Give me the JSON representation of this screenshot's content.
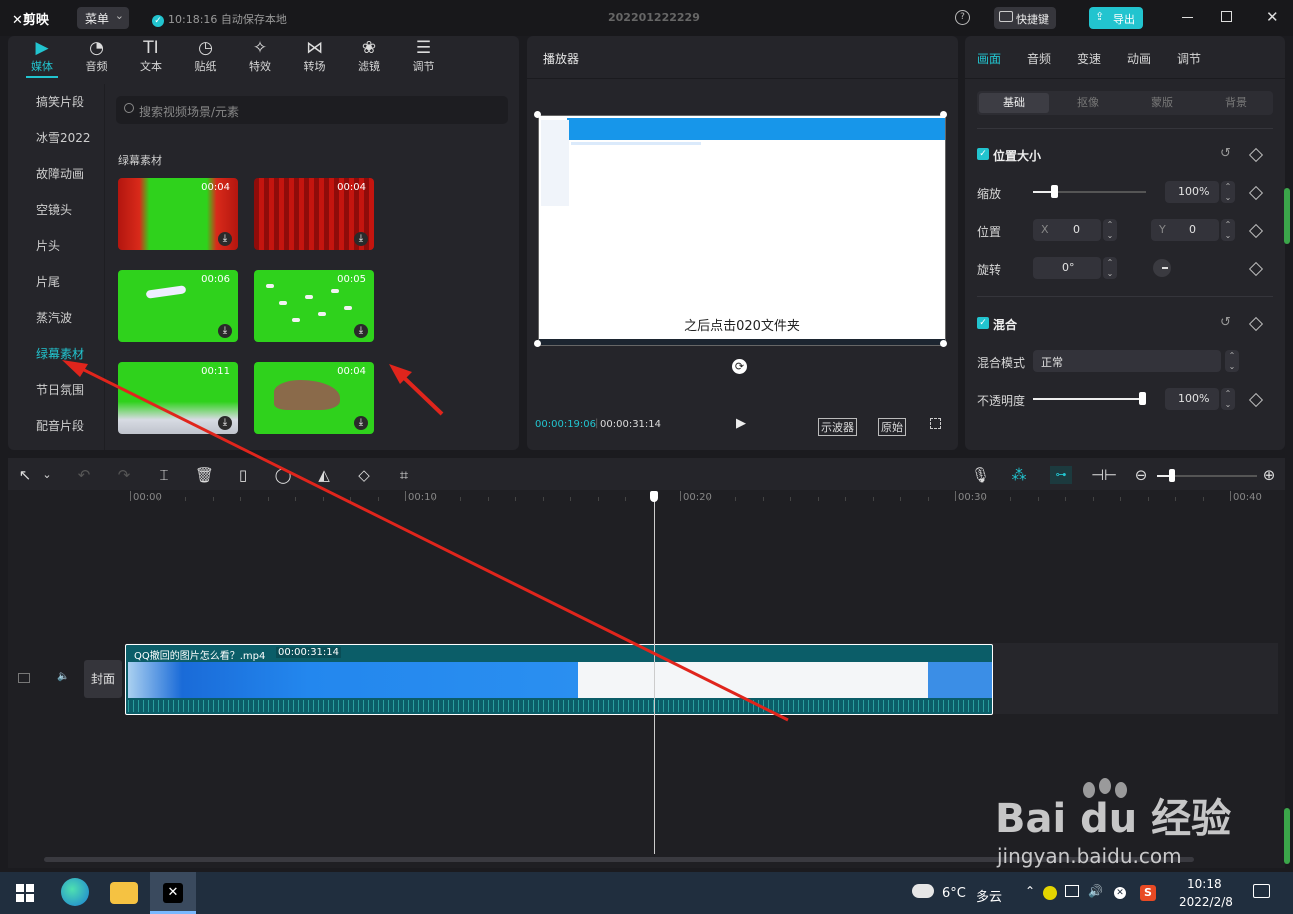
{
  "app": {
    "logo": "剪映",
    "menu_label": "菜单",
    "autosave": "10:18:16 自动保存本地",
    "project_title": "202201222229",
    "shortcut_label": "快捷键",
    "export_label": "导出"
  },
  "media_toolbar": [
    {
      "icon": "media-icon",
      "glyph": "▶",
      "label": "媒体"
    },
    {
      "icon": "audio-icon",
      "glyph": "◔",
      "label": "音频"
    },
    {
      "icon": "text-icon",
      "glyph": "TI",
      "label": "文本"
    },
    {
      "icon": "sticker-icon",
      "glyph": "◷",
      "label": "贴纸"
    },
    {
      "icon": "effects-icon",
      "glyph": "✧",
      "label": "特效"
    },
    {
      "icon": "transition-icon",
      "glyph": "⋈",
      "label": "转场"
    },
    {
      "icon": "filter-icon",
      "glyph": "❀",
      "label": "滤镜"
    },
    {
      "icon": "adjust-icon",
      "glyph": "☰",
      "label": "调节"
    }
  ],
  "categories": [
    "搞笑片段",
    "冰雪2022",
    "故障动画",
    "空镜头",
    "片头",
    "片尾",
    "蒸汽波",
    "绿幕素材",
    "节日氛围",
    "配音片段"
  ],
  "active_category": "绿幕素材",
  "search_placeholder": "搜索视频场景/元素",
  "section_title": "绿幕素材",
  "thumbnails": [
    {
      "duration": "00:04",
      "kind": "curtain-green"
    },
    {
      "duration": "00:04",
      "kind": "curtain-red"
    },
    {
      "duration": "00:06",
      "kind": "plane"
    },
    {
      "duration": "00:05",
      "kind": "birds"
    },
    {
      "duration": "00:11",
      "kind": "clouds"
    },
    {
      "duration": "00:04",
      "kind": "dinosaur"
    }
  ],
  "player": {
    "title": "播放器",
    "subtitle": "之后点击020文件夹",
    "current_time": "00:00:19:06",
    "total_time": "00:00:31:14",
    "scope_label": "示波器",
    "original_label": "原始"
  },
  "inspector": {
    "tabs": [
      "画面",
      "音频",
      "变速",
      "动画",
      "调节"
    ],
    "active_tab": "画面",
    "subtabs": [
      "基础",
      "抠像",
      "蒙版",
      "背景"
    ],
    "active_subtab": "基础",
    "position_size": {
      "title": "位置大小",
      "scale_label": "缩放",
      "scale_value": "100%",
      "scale_fraction": 0.04,
      "position_label": "位置",
      "x_label": "X",
      "x_value": "0",
      "y_label": "Y",
      "y_value": "0",
      "rotate_label": "旋转",
      "rotate_value": "0°"
    },
    "blend": {
      "title": "混合",
      "mode_label": "混合模式",
      "mode_value": "正常",
      "opacity_label": "不透明度",
      "opacity_value": "100%",
      "opacity_fraction": 1.0
    }
  },
  "timeline": {
    "ticks": [
      "00:00",
      "00:10",
      "00:20",
      "00:30",
      "00:40"
    ],
    "clip_name": "QQ撤回的图片怎么看？.mp4",
    "clip_duration": "00:00:31:14",
    "cover_label": "封面"
  },
  "taskbar": {
    "weather_temp": "6°C",
    "weather_desc": "多云",
    "time": "10:18",
    "date": "2022/2/8"
  },
  "watermark": {
    "brand": "Bai du 经验",
    "url": "jingyan.baidu.com"
  },
  "colors": {
    "accent": "#22c4cf",
    "green_screen": "#2fd21c",
    "arrow_red": "#e0251c",
    "clip_teal": "#0b5d68"
  }
}
